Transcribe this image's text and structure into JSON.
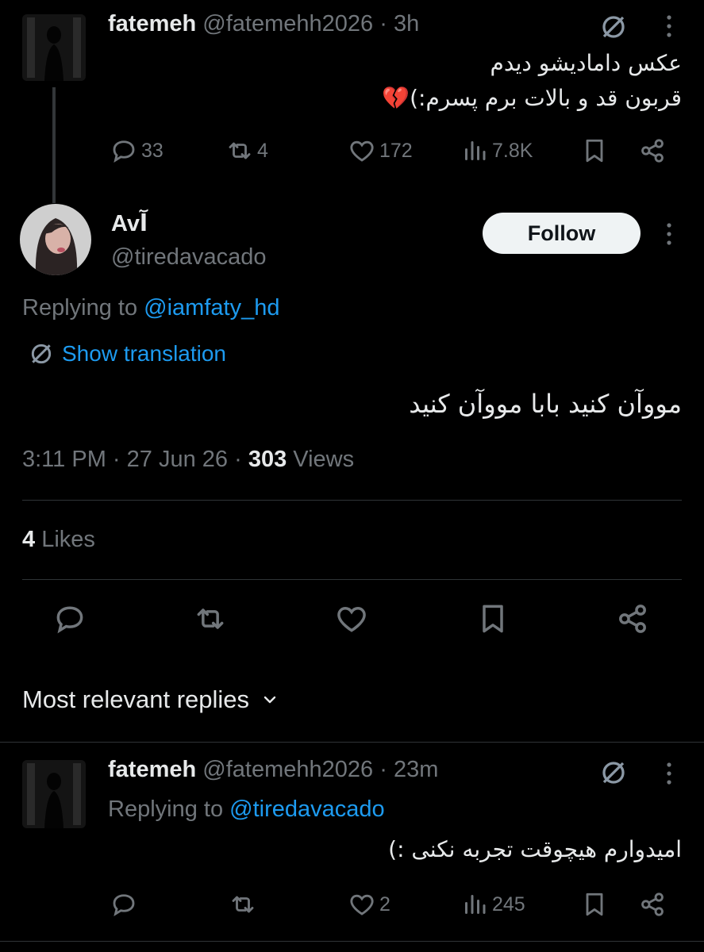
{
  "parent_tweet": {
    "name": "fatemeh",
    "handle": "@fatemehh2026",
    "sep": "·",
    "time": "3h",
    "text_line1": "عکس دامادیشو دیدم",
    "text_line2": "قربون قد و بالات برم پسرم:)💔",
    "replies": "33",
    "retweets": "4",
    "likes": "172",
    "views": "7.8K"
  },
  "main_tweet": {
    "name": "Avآ",
    "handle": "@tiredavacado",
    "follow_label": "Follow",
    "replying_prefix": "Replying to",
    "replying_handle": "@iamfaty_hd",
    "show_translation": "Show translation",
    "text": "مووآن کنید بابا مووآن کنید",
    "time": "3:11 PM",
    "sep": "·",
    "date": "27 Jun 26",
    "views_count": "303",
    "views_label": "Views",
    "likes_count": "4",
    "likes_label": "Likes"
  },
  "replies_section": {
    "sort_label": "Most relevant replies"
  },
  "reply_tweet": {
    "name": "fatemeh",
    "handle": "@fatemehh2026",
    "sep": "·",
    "time": "23m",
    "replying_prefix": "Replying to",
    "replying_handle": "@tiredavacado",
    "text": "امیدوارم هیچوقت تجربه نکنی :)",
    "replies": "",
    "retweets": "",
    "likes": "2",
    "views": "245"
  },
  "colors": {
    "background": "#000000",
    "text": "#e7e9ea",
    "secondary": "#71767b",
    "accent": "#1d9bf0",
    "divider": "#2f3336"
  }
}
